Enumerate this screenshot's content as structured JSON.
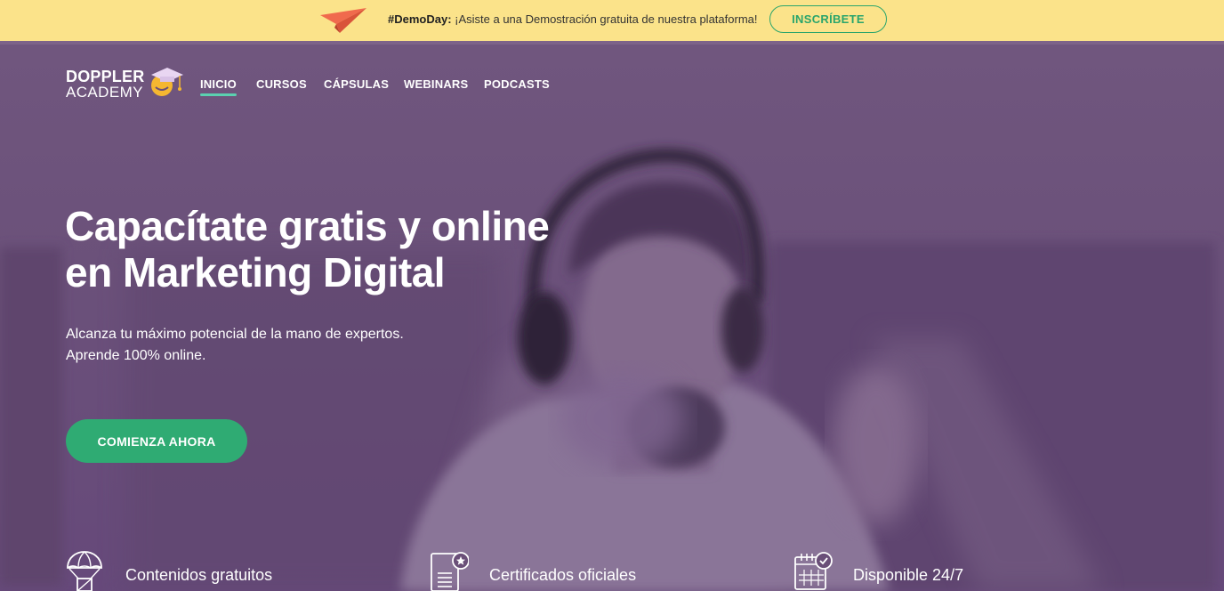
{
  "promo": {
    "hashtag": "#DemoDay:",
    "message": " ¡Asiste a una Demostración gratuita de nuestra plataforma!",
    "button_label": "INSCRÍBETE",
    "icon": "paper-plane-icon"
  },
  "brand": {
    "line1": "DOPPLER",
    "line2": "ACADEMY",
    "mascot_icon": "graduation-mascot-icon"
  },
  "nav": {
    "items": [
      {
        "label": "INICIO",
        "active": true
      },
      {
        "label": "CURSOS",
        "active": false
      },
      {
        "label": "CÁPSULAS",
        "active": false
      },
      {
        "label": "WEBINARS",
        "active": false
      },
      {
        "label": "PODCASTS",
        "active": false
      }
    ]
  },
  "hero": {
    "title_line1": "Capacítate gratis y online",
    "title_line2": "en Marketing Digital",
    "subtitle_line1": "Alcanza tu máximo potencial de la mano de expertos.",
    "subtitle_line2": "Aprende 100% online.",
    "cta_label": "COMIENZA AHORA"
  },
  "features": [
    {
      "label": "Contenidos gratuitos",
      "icon": "parachute-box-icon"
    },
    {
      "label": "Certificados oficiales",
      "icon": "certificate-icon"
    },
    {
      "label": "Disponible 24/7",
      "icon": "calendar-check-icon"
    }
  ],
  "colors": {
    "promo_bg": "#fbe38a",
    "accent_green": "#2fab73",
    "hero_overlay": "#6b517a",
    "nav_underline": "#5bd1b0",
    "plane": "#f06a4d"
  }
}
